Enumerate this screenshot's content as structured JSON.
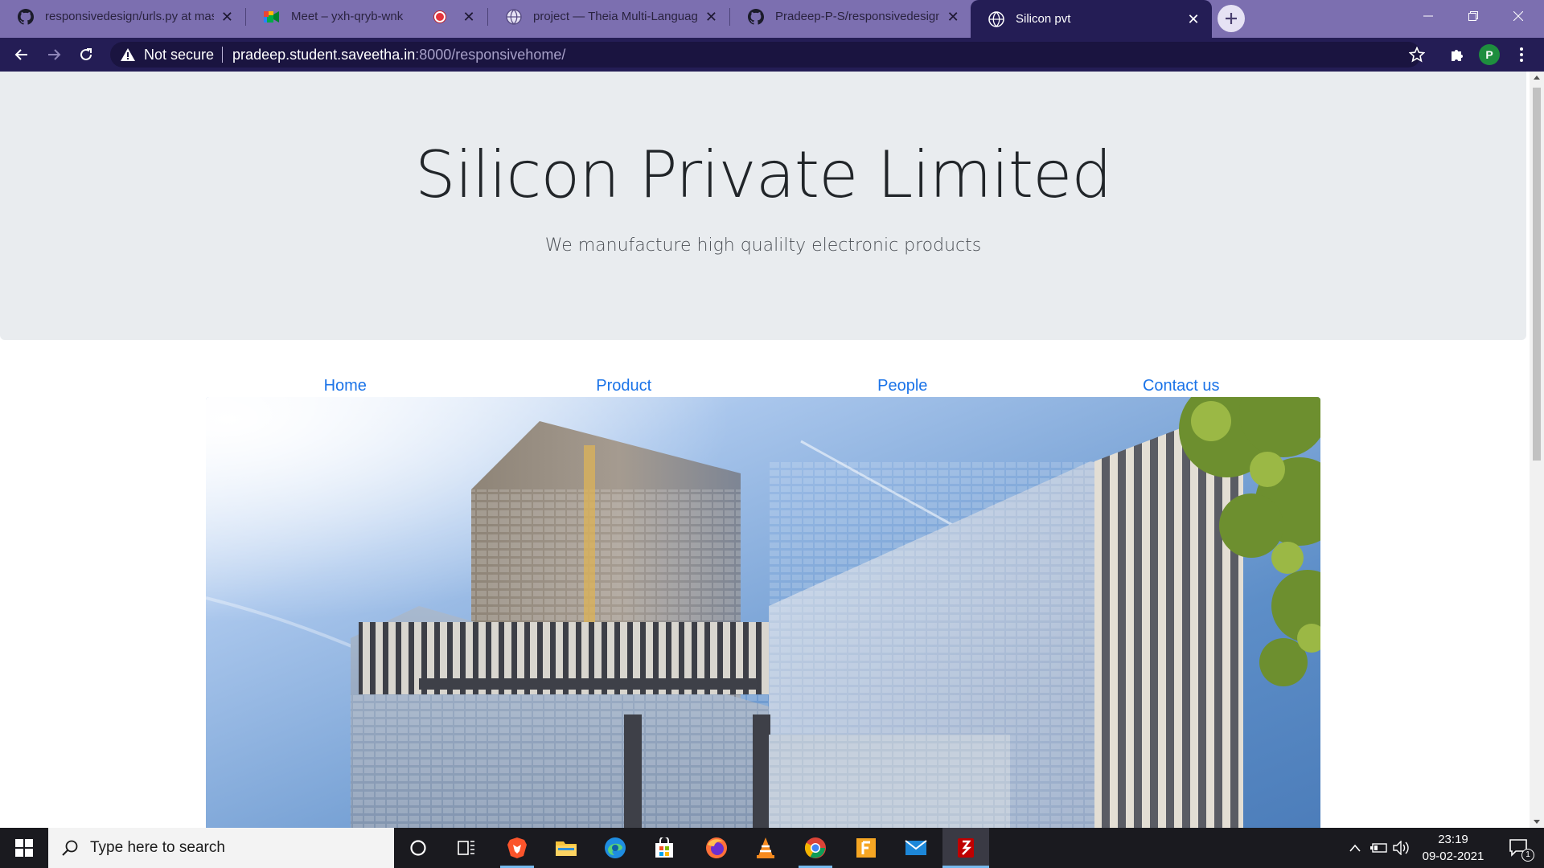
{
  "browser": {
    "tabs": [
      {
        "title": "responsivedesign/urls.py at mast",
        "icon": "github-icon",
        "active": false
      },
      {
        "title": "Meet – yxh-qryb-wnk",
        "icon": "meet-icon",
        "active": false,
        "recording": true
      },
      {
        "title": "project — Theia Multi-Language",
        "icon": "globe-icon",
        "active": false
      },
      {
        "title": "Pradeep-P-S/responsivedesign",
        "icon": "github-icon",
        "active": false
      },
      {
        "title": "Silicon pvt",
        "icon": "globe-icon",
        "active": true
      }
    ],
    "address": {
      "security": "Not secure",
      "host": "pradeep.student.saveetha.in",
      "path": ":8000/responsivehome/"
    },
    "profile_initial": "P"
  },
  "page": {
    "heading": "Silicon Private Limited",
    "tagline": "We manufacture high qualilty electronic products",
    "nav": [
      "Home",
      "Product",
      "People",
      "Contact us"
    ]
  },
  "taskbar": {
    "search_placeholder": "Type here to search",
    "time": "23:19",
    "date": "09-02-2021",
    "notification_count": "1"
  },
  "colors": {
    "tabstrip": "#7c6fb0",
    "toolbar": "#241d55",
    "jumbotron": "#e9ecef",
    "link": "#1a73e8"
  }
}
